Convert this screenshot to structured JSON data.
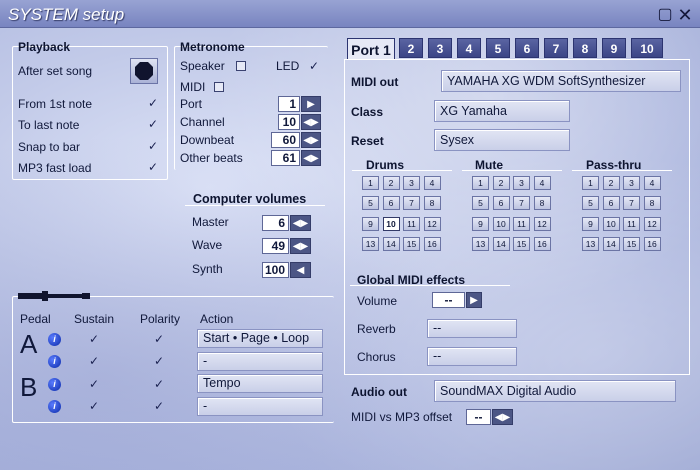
{
  "window": {
    "title": "SYSTEM setup",
    "minimize_icon": "▢",
    "close_icon": "✕"
  },
  "playback": {
    "title": "Playback",
    "after_set_song": "After set song",
    "items": [
      {
        "label": "From 1st note",
        "checked": "✓"
      },
      {
        "label": "To last note",
        "checked": "✓"
      },
      {
        "label": "Snap to bar",
        "checked": "✓"
      },
      {
        "label": "MP3 fast load",
        "checked": "✓"
      }
    ]
  },
  "metronome": {
    "title": "Metronome",
    "speaker": "Speaker",
    "led": "LED",
    "led_check": "✓",
    "midi": "MIDI",
    "rows": [
      {
        "label": "Port",
        "value": "1"
      },
      {
        "label": "Channel",
        "value": "10"
      },
      {
        "label": "Downbeat",
        "value": "60"
      },
      {
        "label": "Other beats",
        "value": "61"
      }
    ]
  },
  "volumes": {
    "title": "Computer volumes",
    "rows": [
      {
        "label": "Master",
        "value": "6"
      },
      {
        "label": "Wave",
        "value": "49"
      },
      {
        "label": "Synth",
        "value": "100"
      }
    ]
  },
  "pedal": {
    "headers": {
      "pedal": "Pedal",
      "sustain": "Sustain",
      "polarity": "Polarity",
      "action": "Action"
    },
    "a": "A",
    "b": "B",
    "info_glyph": "i",
    "check": "✓",
    "actions": [
      "Start • Page • Loop",
      "-",
      "Tempo",
      "-"
    ]
  },
  "ports": {
    "tabs": [
      "Port 1",
      "2",
      "3",
      "4",
      "5",
      "6",
      "7",
      "8",
      "9",
      "10"
    ],
    "midi_out_label": "MIDI out",
    "midi_out": "YAMAHA XG WDM SoftSynthesizer",
    "class_label": "Class",
    "class": "XG  Yamaha",
    "reset_label": "Reset",
    "reset": "Sysex",
    "groups": [
      "Drums",
      "Mute",
      "Pass-thru"
    ],
    "numbers": [
      "1",
      "2",
      "3",
      "4",
      "5",
      "6",
      "7",
      "8",
      "9",
      "10",
      "11",
      "12",
      "13",
      "14",
      "15",
      "16"
    ],
    "drums_selected": "10"
  },
  "global": {
    "title": "Global MIDI effects",
    "volume": "Volume",
    "volume_value": "--",
    "reverb": "Reverb",
    "reverb_value": "--",
    "chorus": "Chorus",
    "chorus_value": "--"
  },
  "audio": {
    "label": "Audio out",
    "value": "SoundMAX Digital Audio",
    "offset_label": "MIDI vs MP3 offset",
    "offset_value": "--"
  }
}
